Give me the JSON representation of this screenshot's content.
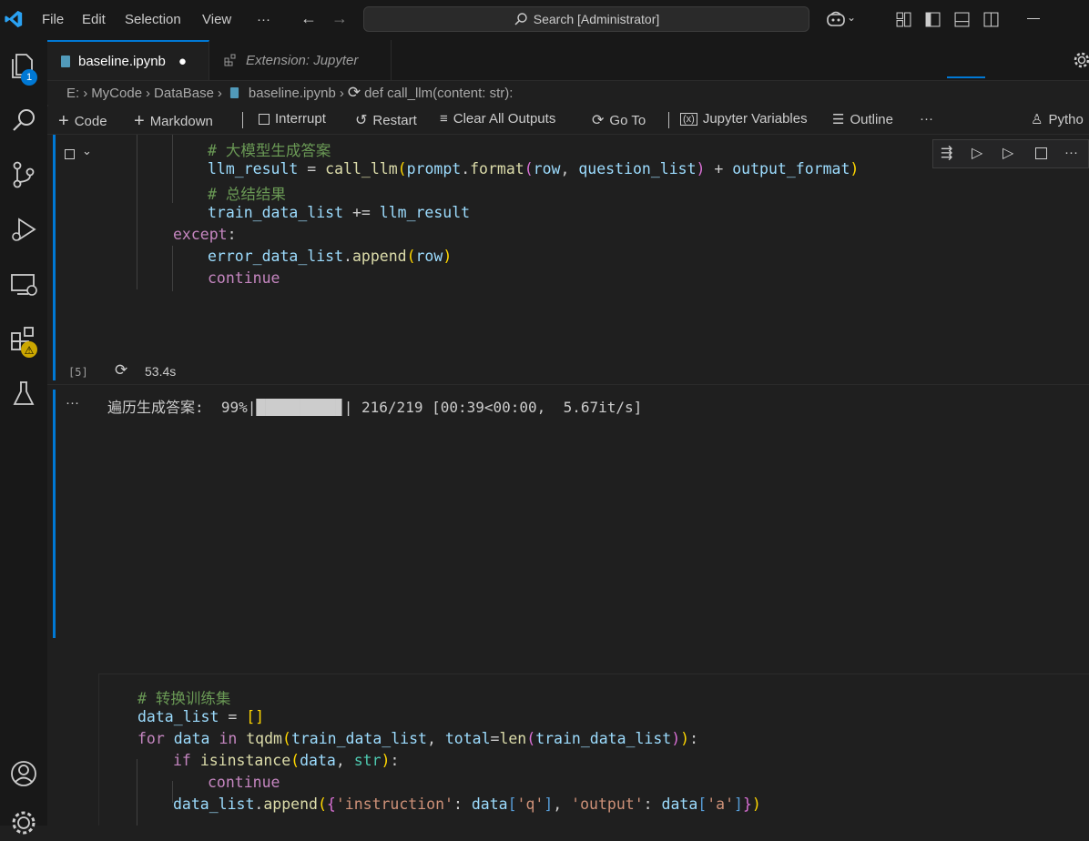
{
  "menu": {
    "file": "File",
    "edit": "Edit",
    "selection": "Selection",
    "view": "View",
    "more": "···"
  },
  "search": {
    "text": "Search [Administrator]"
  },
  "tabs": [
    {
      "label": "baseline.ipynb",
      "modified": "●"
    },
    {
      "label": "Extension: Jupyter"
    }
  ],
  "breadcrumb": {
    "drive": "E:",
    "folder1": "MyCode",
    "folder2": "DataBase",
    "file": "baseline.ipynb",
    "symbol": "def call_llm(content: str):"
  },
  "toolbar": {
    "code": "Code",
    "markdown": "Markdown",
    "interrupt": "Interrupt",
    "restart": "Restart",
    "clear": "Clear All Outputs",
    "goto": "Go To",
    "variables": "Jupyter Variables",
    "outline": "Outline",
    "more": "···",
    "kernel": "Pytho"
  },
  "activity": {
    "explorer_badge": "1"
  },
  "cell1": {
    "lines": {
      "c1": "# 大模型生成答案",
      "c2": "# 总结结果",
      "exec_count": "[5]",
      "duration": "53.4s"
    }
  },
  "output": {
    "more": "···",
    "text": "遍历生成答案:  99%|█████████▊| 216/219 [00:39<00:00,  5.67it/s]"
  },
  "cell2": {
    "comment": "# 转换训练集"
  },
  "colors": {
    "accent": "#0078d4",
    "bg": "#1f1f1f",
    "bar": "#181818"
  }
}
